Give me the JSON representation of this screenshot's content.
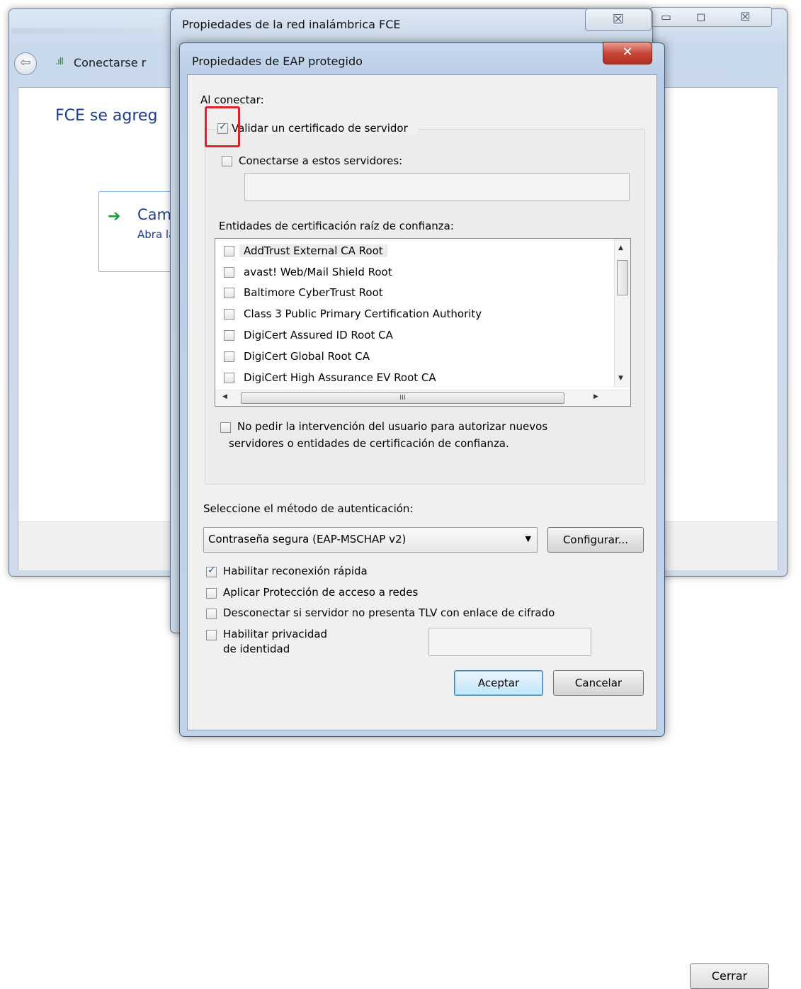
{
  "background_window": {
    "breadcrumb": "Conectarse r",
    "heading": "FCE se agreg",
    "option_title": "Cam",
    "option_subtitle": "Abra la",
    "close_button": "Cerrar"
  },
  "wireless_properties_window": {
    "title": "Propiedades de la red inalámbrica FCE"
  },
  "eap_dialog": {
    "title": "Propiedades de EAP protegido",
    "on_connect_label": "Al conectar:",
    "validate_certificate": {
      "label": "Validar un certificado de servidor",
      "checked": true
    },
    "connect_to_servers": {
      "label": "Conectarse a estos servidores:",
      "checked": false,
      "value": ""
    },
    "trusted_root_label": "Entidades de certificación raíz de confianza:",
    "trusted_roots": [
      {
        "name": "AddTrust External CA Root",
        "checked": false
      },
      {
        "name": "avast! Web/Mail Shield Root",
        "checked": false
      },
      {
        "name": "Baltimore CyberTrust Root",
        "checked": false
      },
      {
        "name": "Class 3 Public Primary Certification Authority",
        "checked": false
      },
      {
        "name": "DigiCert Assured ID Root CA",
        "checked": false
      },
      {
        "name": "DigiCert Global Root CA",
        "checked": false
      },
      {
        "name": "DigiCert High Assurance EV Root CA",
        "checked": false
      }
    ],
    "hscroll_grip": "III",
    "no_prompt": {
      "line1": "No pedir la intervención del usuario para autorizar nuevos",
      "line2": "servidores o entidades de certificación de confianza.",
      "checked": false
    },
    "auth_method_label": "Seleccione el método de autenticación:",
    "auth_method_value": "Contraseña segura (EAP-MSCHAP v2)",
    "configure_button": "Configurar...",
    "fast_reconnect": {
      "label": "Habilitar reconexión rápida",
      "checked": true
    },
    "nap": {
      "label": "Aplicar Protección de acceso a redes",
      "checked": false
    },
    "disconnect_tlv": {
      "label": "Desconectar si servidor no presenta TLV con enlace de cifrado",
      "checked": false
    },
    "identity_privacy": {
      "line1": "Habilitar privacidad",
      "line2": "de identidad",
      "checked": false,
      "value": ""
    },
    "ok_button": "Aceptar",
    "cancel_button": "Cancelar"
  },
  "colors": {
    "highlight_box": "#e0202c",
    "link_blue": "#1e3d8f",
    "close_red": "#c7463a"
  }
}
